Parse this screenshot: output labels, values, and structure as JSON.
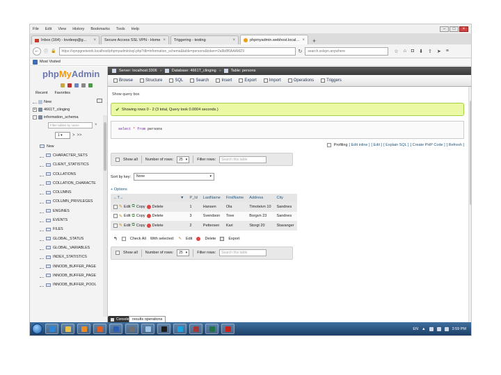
{
  "window": {
    "menu": [
      "File",
      "Edit",
      "View",
      "History",
      "Bookmarks",
      "Tools",
      "Help"
    ]
  },
  "tabs": [
    {
      "label": "Inbox (164) - lovdeep@g...",
      "favicon_color": "#c23b22"
    },
    {
      "label": "Secure Access SSL VPN - Home",
      "favicon_color": "#cfcfcf"
    },
    {
      "label": "Triggering - testing",
      "favicon_color": "#cfcfcf"
    },
    {
      "label": "phpmyadmin.webhost.localhost",
      "favicon_color": "#f29a12",
      "active": true
    }
  ],
  "navbar": {
    "url": "https://vpnpgnetwork.localhost/phpmyadmin/sql.php?db=information_schema&table=persons&token=2a9b8f0AAAMZ9",
    "search_placeholder": "search.sslvpn.anywhere",
    "icons": [
      "star-icon",
      "home-icon",
      "pocket-icon",
      "download-icon",
      "back-home-icon",
      "send-icon",
      "menu-icon"
    ]
  },
  "bookmarks": {
    "label": "Most Visited"
  },
  "pma": {
    "logo": {
      "php": "php",
      "my": "My",
      "admin": "Admin"
    },
    "recent": "Recent",
    "favorites": "Favorites",
    "tree": [
      {
        "label": "New",
        "expand": ""
      },
      {
        "label": "4661T_clinging",
        "expand": "+"
      },
      {
        "label": "information_schema",
        "expand": "-"
      }
    ],
    "filter_placeholder": "Filter tables by name",
    "page": "1",
    "tables": [
      "New",
      "CHARACTER_SETS",
      "CLIENT_STATISTICS",
      "COLLATIONS",
      "COLLATION_CHARACTE",
      "COLUMNS",
      "COLUMN_PRIVILEGES",
      "ENGINES",
      "EVENTS",
      "FILES",
      "GLOBAL_STATUS",
      "GLOBAL_VARIABLES",
      "INDEX_STATISTICS",
      "INNODB_BUFFER_PAGE",
      "INNODB_BUFFER_PAGE",
      "INNODB_BUFFER_POOL"
    ]
  },
  "crumb": {
    "server": "Server: localhost:3306",
    "database": "Database: 4661T_clinging",
    "table": "Table: persons"
  },
  "menutabs": [
    "Browse",
    "Structure",
    "SQL",
    "Search",
    "Insert",
    "Export",
    "Import",
    "Operations",
    "Triggers"
  ],
  "main": {
    "show_query_box": "Show query box",
    "success": "Showing rows 0 - 2 (3 total, Query took 0.0004 seconds.)",
    "sql": {
      "select": "select",
      "star": "*",
      "from": "from",
      "table": "persons"
    },
    "query_links": [
      "Profiling",
      "[ Edit inline ]",
      "[ Edit ]",
      "[ Explain SQL ]",
      "[ Create PHP Code ]",
      "[ Refresh ]"
    ],
    "show_all": "Show all",
    "number_of_rows_label": "Number of rows:",
    "number_of_rows": "25",
    "filter_rows_label": "Filter rows:",
    "filter_rows_placeholder": "Search this table",
    "sort_by_key_label": "Sort by key:",
    "sort_by_key_value": "None",
    "options": "+ Options",
    "columns": [
      "P_Id",
      "LastName",
      "FirstName",
      "Address",
      "City"
    ],
    "actions": {
      "edit": "Edit",
      "copy": "Copy",
      "delete": "Delete"
    },
    "rows": [
      [
        "1",
        "Hansen",
        "Ola",
        "Timoteivn 10",
        "Sandnes"
      ],
      [
        "3",
        "Svendson",
        "Tove",
        "Borgvn 23",
        "Sandnes"
      ],
      [
        "2",
        "Pettersen",
        "Kari",
        "Storgt 20",
        "Stavanger"
      ]
    ],
    "bulk": {
      "check_all": "Check All",
      "with_selected": "With selected:",
      "change": "Edit",
      "delete": "Delete",
      "export": "Export"
    },
    "console": "Console",
    "results_operations": "results operations"
  },
  "taskbar": {
    "apps": [
      {
        "name": "ie-icon",
        "color": "#2a86d8"
      },
      {
        "name": "explorer-icon",
        "color": "#e8c24a"
      },
      {
        "name": "media-player-icon",
        "color": "#f08a24"
      },
      {
        "name": "firefox-icon",
        "color": "#e25d1f"
      },
      {
        "name": "word-icon",
        "color": "#2b5fb3"
      },
      {
        "name": "putty-icon",
        "color": "#6f6f6f"
      },
      {
        "name": "notepad-icon",
        "color": "#9fc4e8"
      },
      {
        "name": "terminal-icon",
        "color": "#1d1d1d"
      },
      {
        "name": "skype-icon",
        "color": "#19a3e0"
      },
      {
        "name": "access-icon",
        "color": "#a4373a"
      },
      {
        "name": "excel-icon",
        "color": "#217346"
      },
      {
        "name": "acrobat-icon",
        "color": "#c8231a"
      }
    ],
    "lang": "EN",
    "time": "3:59 PM"
  }
}
